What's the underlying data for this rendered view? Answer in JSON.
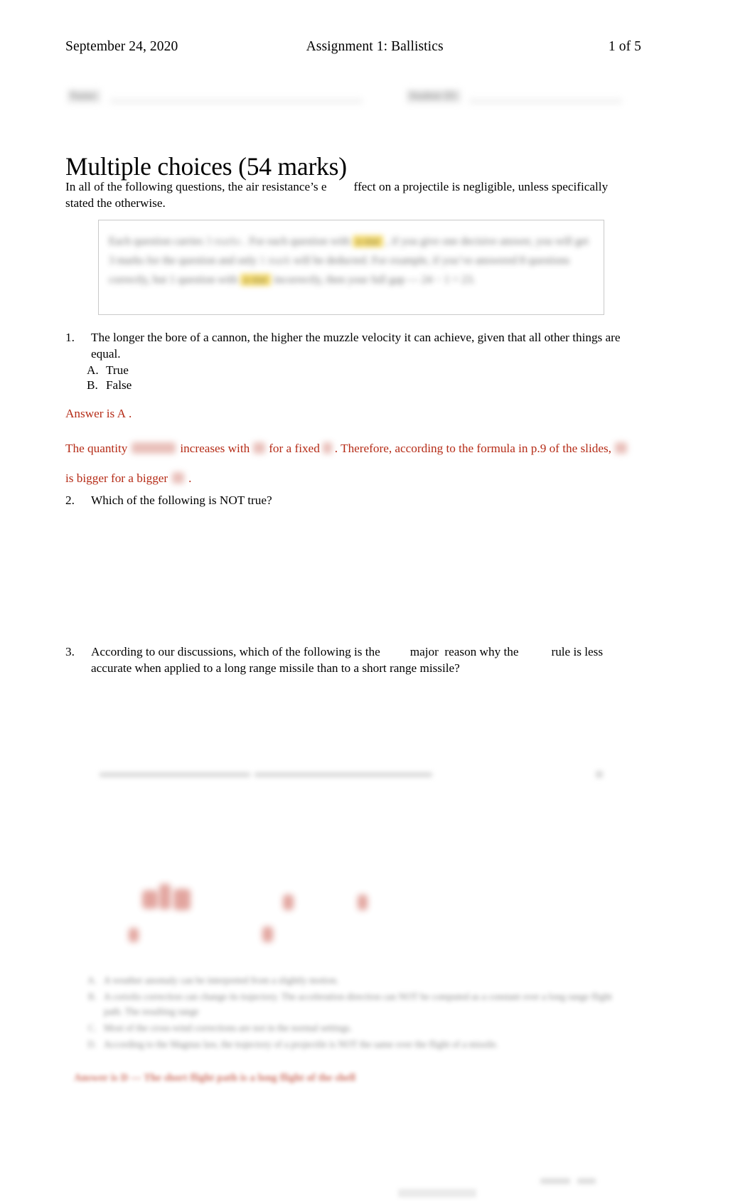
{
  "document": {
    "header": {
      "date": "September 24, 2020",
      "title": "Assignment 1: Ballistics",
      "page_indicator": "1 of 5"
    },
    "id_row": {
      "name_label": "Name:",
      "student_id_label": "Student ID:"
    },
    "section_title": "Multiple choices (54 marks)",
    "intro": {
      "part1": "In all of the following questions, the air resistance’s e",
      "part2": "ffect on a projectile is negligible, unless specifically stated the otherwise."
    },
    "note_box": {
      "line1_a": "Each question carries",
      "line1_b": "3 marks",
      "line1_c": ". For each question with",
      "line1_d": "a star",
      "line1_e": ", if you give one decisive",
      "line2_a": "answer, you will get 3 marks for the question and only",
      "line2_b": "1 mark",
      "line2_c": "will be deducted.",
      "line3_a": "For example, if you’ve answered 8 questions correctly, but 1 question with",
      "line3_b": "a star",
      "line4": "incorrectly, then your full gap — 24 − 1 = 23."
    },
    "questions": [
      {
        "number": "1.",
        "text": "The longer the bore of a cannon, the higher the muzzle velocity it can achieve, given that all other things are equal.",
        "options": [
          {
            "letter": "A.",
            "label": "True"
          },
          {
            "letter": "B.",
            "label": "False"
          }
        ]
      },
      {
        "number": "2.",
        "text": "Which of the following is NOT true?"
      },
      {
        "number": "3.",
        "text_a": "According to our discussions, which of the following is the",
        "text_b": "major",
        "text_c": "reason why the",
        "text_d": "rule is less accurate when applied to a long range missile than to a short range missile?"
      }
    ],
    "answers": {
      "q1_line": "Answer is A",
      "q1_line_end": ".",
      "q1_para_a": "The quantity",
      "q1_para_b": "increases with",
      "q1_para_c": "for a fixed",
      "q1_para_d": ". Therefore, according to the formula in p.9 of",
      "q1_para_e": "the slides,",
      "q1_para_f": "is bigger for a bigger",
      "q1_para_g": "."
    },
    "lower_redacted_list": [
      {
        "letter": "A.",
        "text": "A weather anomaly can be interpreted from a slightly motion."
      },
      {
        "letter": "B.",
        "text": "A coriolis correction can change its trajectory. The acceleration direction can NOT be computed as a constant over a long range flight path. The resulting range"
      },
      {
        "letter": "C.",
        "text": "Most of the cross-wind corrections are not in the normal settings."
      },
      {
        "letter": "D.",
        "text": "According to the Magnus law, the trajectory of a projectile is NOT the same over the flight of a missile."
      }
    ],
    "lower_red_note": "Answer is D — The short flight path is a long flight of the shell",
    "colors": {
      "annotation_red": "#b52b16",
      "body_text": "#000000",
      "note_box_border": "#c9c9c9",
      "highlight_yellow": "#f2d24b"
    }
  }
}
